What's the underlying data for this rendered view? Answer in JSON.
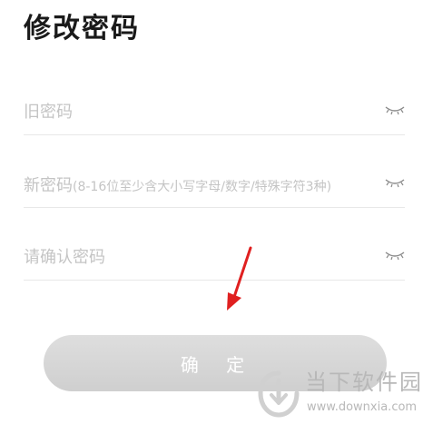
{
  "header": {
    "title": "修改密码"
  },
  "form": {
    "old_password": {
      "placeholder": "旧密码",
      "value": ""
    },
    "new_password": {
      "placeholder_main": "新密码",
      "placeholder_hint": "(8-16位至少含大小写字母/数字/特殊字符3种)",
      "value": ""
    },
    "confirm_password": {
      "placeholder": "请确认密码",
      "value": ""
    },
    "visibility_icon": "eye-closed-icon"
  },
  "actions": {
    "confirm_label": "确 定"
  },
  "annotation": {
    "arrow_color": "#e02020"
  },
  "watermark": {
    "name": "当下软件园",
    "url": "www.downxia.com"
  },
  "colors": {
    "button_bg": "#d6d6d6",
    "placeholder": "#c4c4c4",
    "divider": "#e8e8e8"
  }
}
